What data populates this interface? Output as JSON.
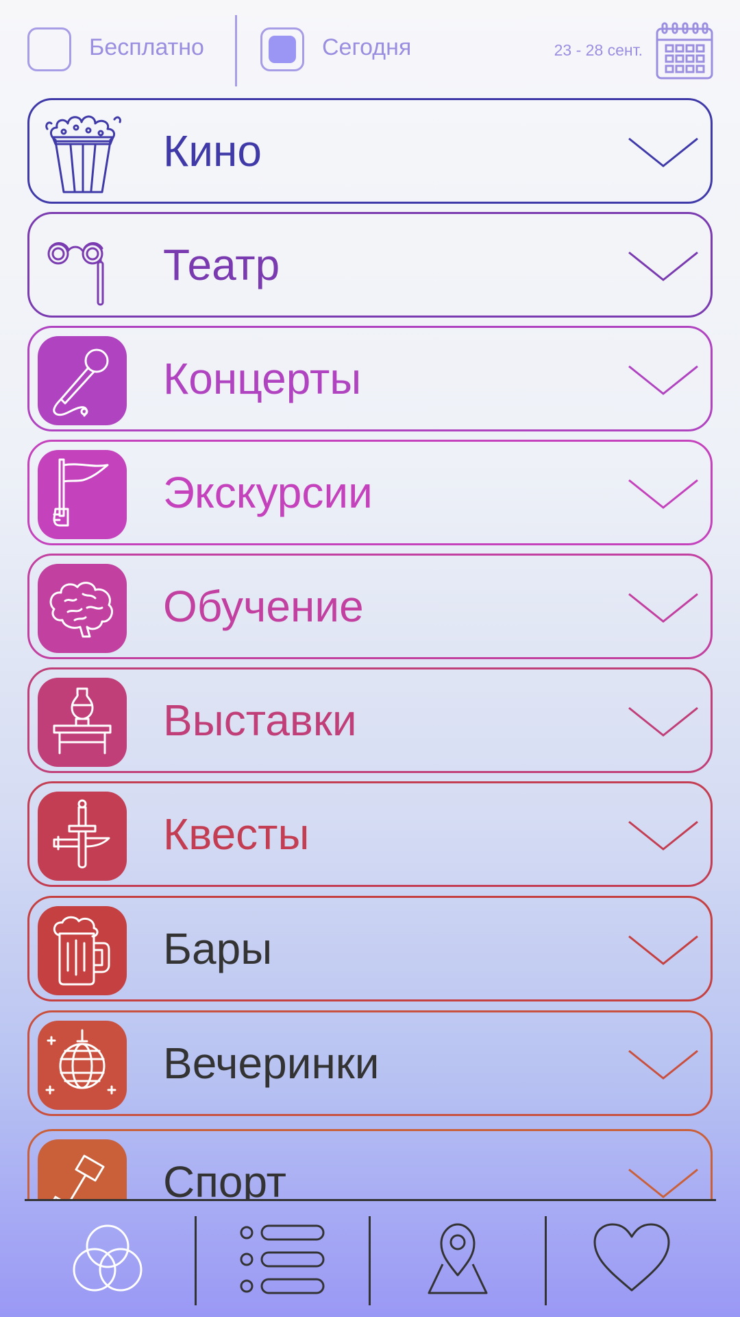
{
  "filters": {
    "free_label": "Бесплатно",
    "free_checked": false,
    "today_label": "Сегодня",
    "today_checked": true,
    "date_range": "23 - 28 сент.",
    "calendar_icon": "calendar-icon"
  },
  "categories": [
    {
      "label": "Кино",
      "icon": "popcorn-icon",
      "color": "#3f3aa8",
      "tile": false
    },
    {
      "label": "Театр",
      "icon": "opera-glasses-icon",
      "color": "#7a3bb0",
      "tile": false
    },
    {
      "label": "Концерты",
      "icon": "microphone-icon",
      "color": "#b044c0",
      "tile": true
    },
    {
      "label": "Экскурсии",
      "icon": "flag-icon",
      "color": "#c443bd",
      "tile": true
    },
    {
      "label": "Обучение",
      "icon": "brain-icon",
      "color": "#c2409f",
      "tile": true
    },
    {
      "label": "Выставки",
      "icon": "vase-exhibit-icon",
      "color": "#c03f78",
      "tile": true
    },
    {
      "label": "Квесты",
      "icon": "sword-icon",
      "color": "#c33e52",
      "tile": true
    },
    {
      "label": "Бары",
      "icon": "beer-mug-icon",
      "color": "#c54040",
      "tile": true,
      "text_color": "#333333"
    },
    {
      "label": "Вечеринки",
      "icon": "disco-ball-icon",
      "color": "#c9503e",
      "tile": true,
      "text_color": "#333333"
    },
    {
      "label": "Спорт",
      "icon": "dumbbell-icon",
      "color": "#c9603a",
      "tile": true,
      "text_color": "#333333"
    }
  ],
  "bottom_nav": [
    {
      "name": "circles-icon"
    },
    {
      "name": "list-icon"
    },
    {
      "name": "map-pin-icon"
    },
    {
      "name": "heart-icon"
    }
  ]
}
